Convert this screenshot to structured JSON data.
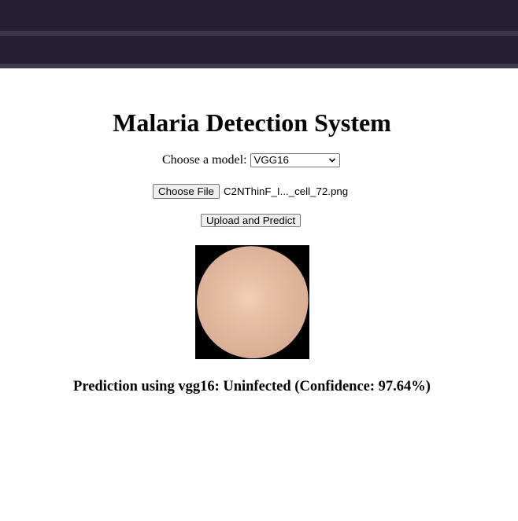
{
  "header": {
    "title": "Malaria Detection System"
  },
  "model": {
    "label": "Choose a model:",
    "selected": "VGG16"
  },
  "file": {
    "button_label": "Choose File",
    "filename": "C2NThinF_I..._cell_72.png"
  },
  "upload": {
    "button_label": "Upload and Predict"
  },
  "result": {
    "text": "Prediction using vgg16: Uninfected (Confidence: 97.64%)"
  },
  "colors": {
    "topbar": "#242031",
    "page_background": "#ffffff"
  }
}
